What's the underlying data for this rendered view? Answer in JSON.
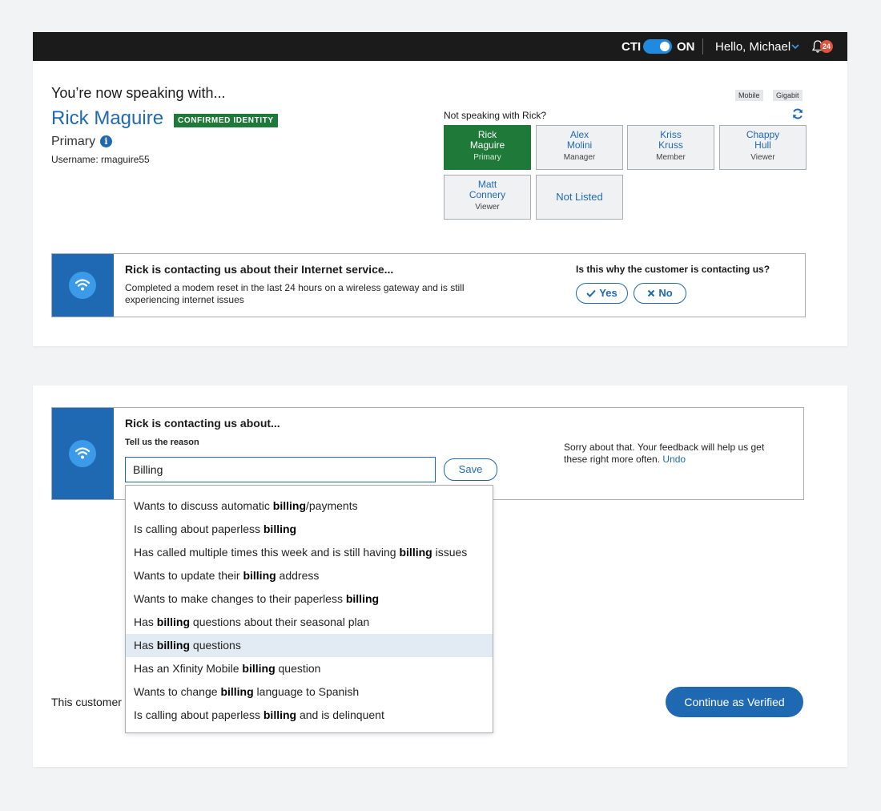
{
  "header": {
    "cti_label": "CTI",
    "cti_state": "ON",
    "greeting": "Hello, Michael",
    "notification_count": "24"
  },
  "identity": {
    "speaking_with": "You’re now speaking with...",
    "name": "Rick Maguire",
    "status_badge": "CONFIRMED IDENTITY",
    "role": "Primary",
    "username": "Username: rmaguire55",
    "tags": [
      "Mobile",
      "Gigabit"
    ],
    "not_speaking_prompt": "Not speaking with Rick?"
  },
  "people": [
    {
      "first": "Rick",
      "last": "Maguire",
      "role": "Primary",
      "selected": true
    },
    {
      "first": "Alex",
      "last": "Molini",
      "role": "Manager"
    },
    {
      "first": "Kriss",
      "last": "Kruss",
      "role": "Member"
    },
    {
      "first": "Chappy",
      "last": "Hull",
      "role": "Viewer"
    },
    {
      "first": "Matt",
      "last": "Connery",
      "role": "Viewer"
    }
  ],
  "not_listed_label": "Not Listed",
  "contact_reason": {
    "title": "Rick is contacting us about their Internet service...",
    "description": "Completed a modem reset in the last 24 hours on a wireless gateway and is still experiencing internet issues",
    "question": "Is this why the customer is contacting us?",
    "yes_label": "Yes",
    "no_label": "No"
  },
  "reason_entry": {
    "title": "Rick is contacting us about...",
    "subtitle": "Tell us the reason",
    "input_value": "Billing",
    "save_label": "Save",
    "feedback": "Sorry about that. Your feedback will help us get these right more often.",
    "undo_label": "Undo"
  },
  "suggestions": [
    {
      "pre": "Wants to discuss automatic ",
      "bold": "billing",
      "post": "/payments"
    },
    {
      "pre": "Is calling about paperless ",
      "bold": "billing",
      "post": ""
    },
    {
      "pre": "Has called multiple times this week and is still having ",
      "bold": "billing",
      "post": " issues"
    },
    {
      "pre": "Wants to update their ",
      "bold": "billing",
      "post": " address"
    },
    {
      "pre": "Wants to make changes to their paperless ",
      "bold": "billing",
      "post": ""
    },
    {
      "pre": "Has ",
      "bold": "billing",
      "post": " questions about their seasonal plan"
    },
    {
      "pre": "Has ",
      "bold": "billing",
      "post": " questions",
      "highlighted": true
    },
    {
      "pre": "Has an Xfinity Mobile ",
      "bold": "billing",
      "post": " question"
    },
    {
      "pre": "Wants to change ",
      "bold": "billing",
      "post": " language to Spanish"
    },
    {
      "pre": "Is calling about paperless ",
      "bold": "billing",
      "post": " and is delinquent"
    }
  ],
  "footer": {
    "customer_text": "This customer",
    "continue_label": "Continue as Verified"
  },
  "colors": {
    "brand_blue": "#1f69b3",
    "confirmed_green": "#1f7a3a",
    "topbar": "#1b1b1b",
    "highlight_row": "#e2ebf3"
  }
}
